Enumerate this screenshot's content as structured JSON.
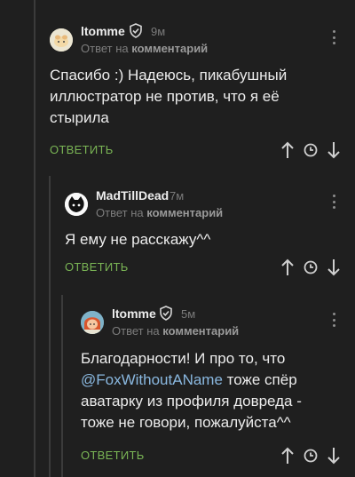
{
  "comments": [
    {
      "author": "ltomme",
      "time": "9м",
      "reply_prefix": "Ответ на",
      "reply_link": "комментарий",
      "lines": [
        "Спасибо :) Надеюсь, пикабушный",
        "иллюстратор не против,  что я её",
        "стырила"
      ],
      "reply_label": "ОТВЕТИТЬ"
    },
    {
      "author": "MadTillDead",
      "time": "7м",
      "reply_prefix": "Ответ на",
      "reply_link": "комментарий",
      "lines": [
        "Я ему не расскажу^^"
      ],
      "reply_label": "ОТВЕТИТЬ"
    },
    {
      "author": "ltomme",
      "time": "5м",
      "reply_prefix": "Ответ на",
      "reply_link": "комментарий",
      "line1": "Благодарности! И про то, что",
      "mention": "@FoxWithoutAName",
      "line2_rest": " тоже спёр",
      "line3": "аватарку из профиля довреда -",
      "line4": "тоже не говори, пожалуйста^^",
      "reply_label": "ОТВЕТИТЬ"
    }
  ],
  "icons": [
    "shield-icon",
    "arrow-up-icon",
    "clock-icon",
    "arrow-down-icon",
    "more-options-icon"
  ],
  "colors": {
    "background": "#1f1f1f",
    "reply_green": "#7ab555",
    "mention_blue": "#8ab8e0"
  }
}
